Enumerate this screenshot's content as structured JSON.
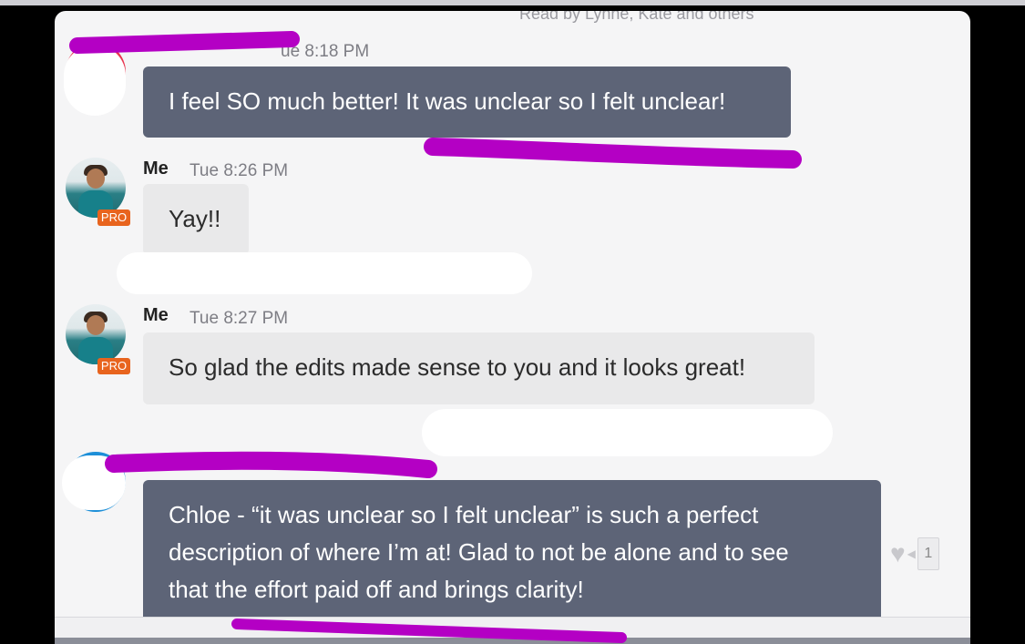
{
  "header": {
    "seen_by": "Read by Lynne, Kate and others"
  },
  "messages": [
    {
      "id": "m1",
      "time": "ue 8:18 PM",
      "text": "I feel SO much better! It was unclear so I felt unclear!"
    },
    {
      "id": "m2",
      "author": "Me",
      "time": "Tue 8:26 PM",
      "text": "Yay!!",
      "badge": "PRO"
    },
    {
      "id": "m3",
      "author": "Me",
      "time": "Tue 8:27 PM",
      "text": "So glad the edits made sense to you and it looks great!",
      "badge": "PRO"
    },
    {
      "id": "m4",
      "lines": [
        "Chloe - “it was unclear so I felt unclear” is such a perfect",
        "description of where I’m at! Glad to not be alone and to see",
        "that the effort paid off and brings clarity!"
      ],
      "likes": "1"
    }
  ],
  "colors": {
    "dark_bubble": "#5d6477",
    "light_bubble": "#e9e9ea",
    "pro_badge": "#e8641e",
    "scribble": "#b400c4"
  },
  "icons": {
    "like": "heart-icon"
  }
}
